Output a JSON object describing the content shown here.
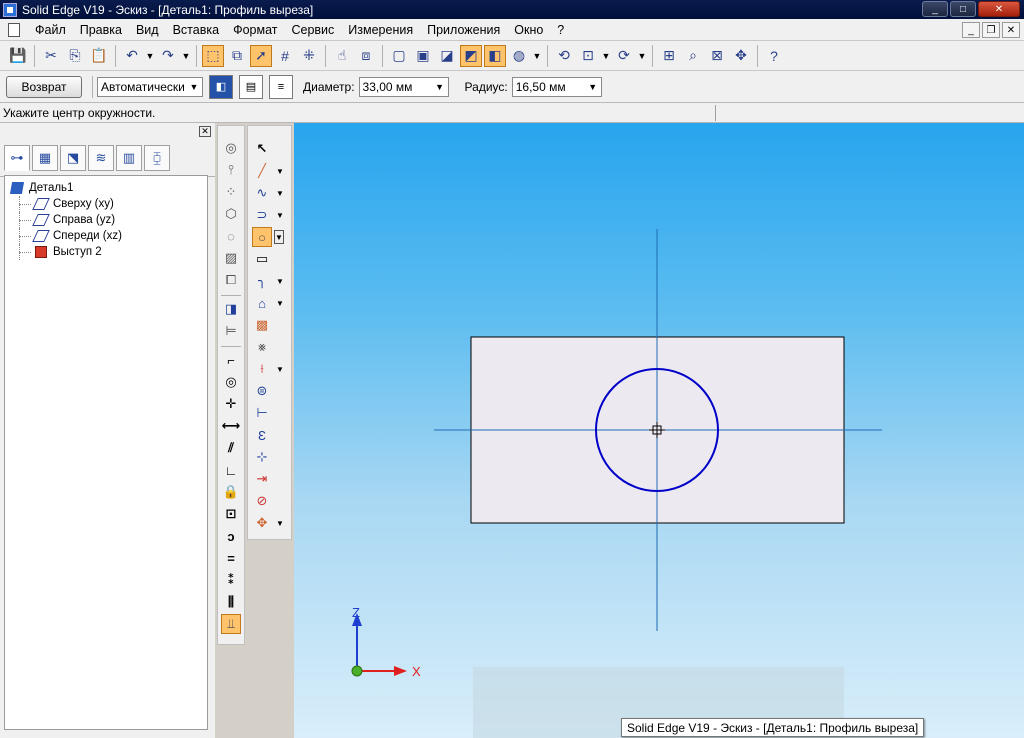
{
  "window": {
    "title": "Solid Edge V19 - Эскиз - [Деталь1: Профиль выреза]",
    "controls": {
      "minimize": "_",
      "maximize": "□",
      "close": "✕"
    }
  },
  "menu": {
    "items": [
      "Файл",
      "Правка",
      "Вид",
      "Вставка",
      "Формат",
      "Сервис",
      "Измерения",
      "Приложения",
      "Окно",
      "?"
    ],
    "mdi_controls": {
      "minimize": "_",
      "restore": "❐",
      "close": "✕"
    }
  },
  "toolbar": {
    "buttons": [
      {
        "name": "save-icon",
        "glyph": "💾"
      },
      {
        "name": "cut-icon",
        "glyph": "✂"
      },
      {
        "name": "copy-icon",
        "glyph": "⎘"
      },
      {
        "name": "paste-icon",
        "glyph": "📋"
      },
      {
        "name": "undo-icon",
        "glyph": "↶"
      },
      {
        "name": "redo-icon",
        "glyph": "↷"
      },
      {
        "name": "select-icon",
        "glyph": "⬚",
        "active": true
      },
      {
        "name": "select-box-icon",
        "glyph": "⧉"
      },
      {
        "name": "pointer-icon",
        "glyph": "➚",
        "active": true
      },
      {
        "name": "grid-icon",
        "glyph": "#"
      },
      {
        "name": "snap-icon",
        "glyph": "⁜"
      },
      {
        "name": "hand-icon",
        "glyph": "☝"
      },
      {
        "name": "layer-icon",
        "glyph": "⧈"
      },
      {
        "name": "view-wire-icon",
        "glyph": "▢"
      },
      {
        "name": "view-hidden-icon",
        "glyph": "▣"
      },
      {
        "name": "view-shaded-icon",
        "glyph": "◪"
      },
      {
        "name": "view-shaded-edge-icon",
        "glyph": "◩",
        "active": true
      },
      {
        "name": "view-cube-icon",
        "glyph": "◧",
        "active": true
      },
      {
        "name": "globe-icon",
        "glyph": "◍"
      },
      {
        "name": "rotate-icon",
        "glyph": "⟲"
      },
      {
        "name": "section-icon",
        "glyph": "⊡"
      },
      {
        "name": "refresh-icon",
        "glyph": "⟳"
      },
      {
        "name": "zoom-area-icon",
        "glyph": "⊞"
      },
      {
        "name": "zoom-icon",
        "glyph": "⌕"
      },
      {
        "name": "fit-icon",
        "glyph": "⊠"
      },
      {
        "name": "pan-icon",
        "glyph": "✥"
      },
      {
        "name": "help-icon",
        "glyph": "?"
      }
    ]
  },
  "command_bar": {
    "back_label": "Возврат",
    "mode_value": "Автоматически",
    "diameter_label": "Диаметр:",
    "diameter_value": "33,00 мм",
    "radius_label": "Радиус:",
    "radius_value": "16,50 мм"
  },
  "prompt": "Укажите центр окружности.",
  "tree": {
    "root": "Деталь1",
    "children": [
      "Сверху (xy)",
      "Справа (yz)",
      "Спереди (xz)",
      "Выступ 2"
    ]
  },
  "axis_labels": {
    "z": "Z",
    "x": "X"
  },
  "colors": {
    "title_bar": "#0a1c4e",
    "active_button": "#ffc36b",
    "sketch_line": "#0000c8",
    "construction_line": "#1e6cb4",
    "z_axis": "#1f3fd0",
    "x_axis": "#e02020"
  },
  "tooltip": "Solid Edge V19 - Эскиз - [Деталь1: Профиль выреза]"
}
